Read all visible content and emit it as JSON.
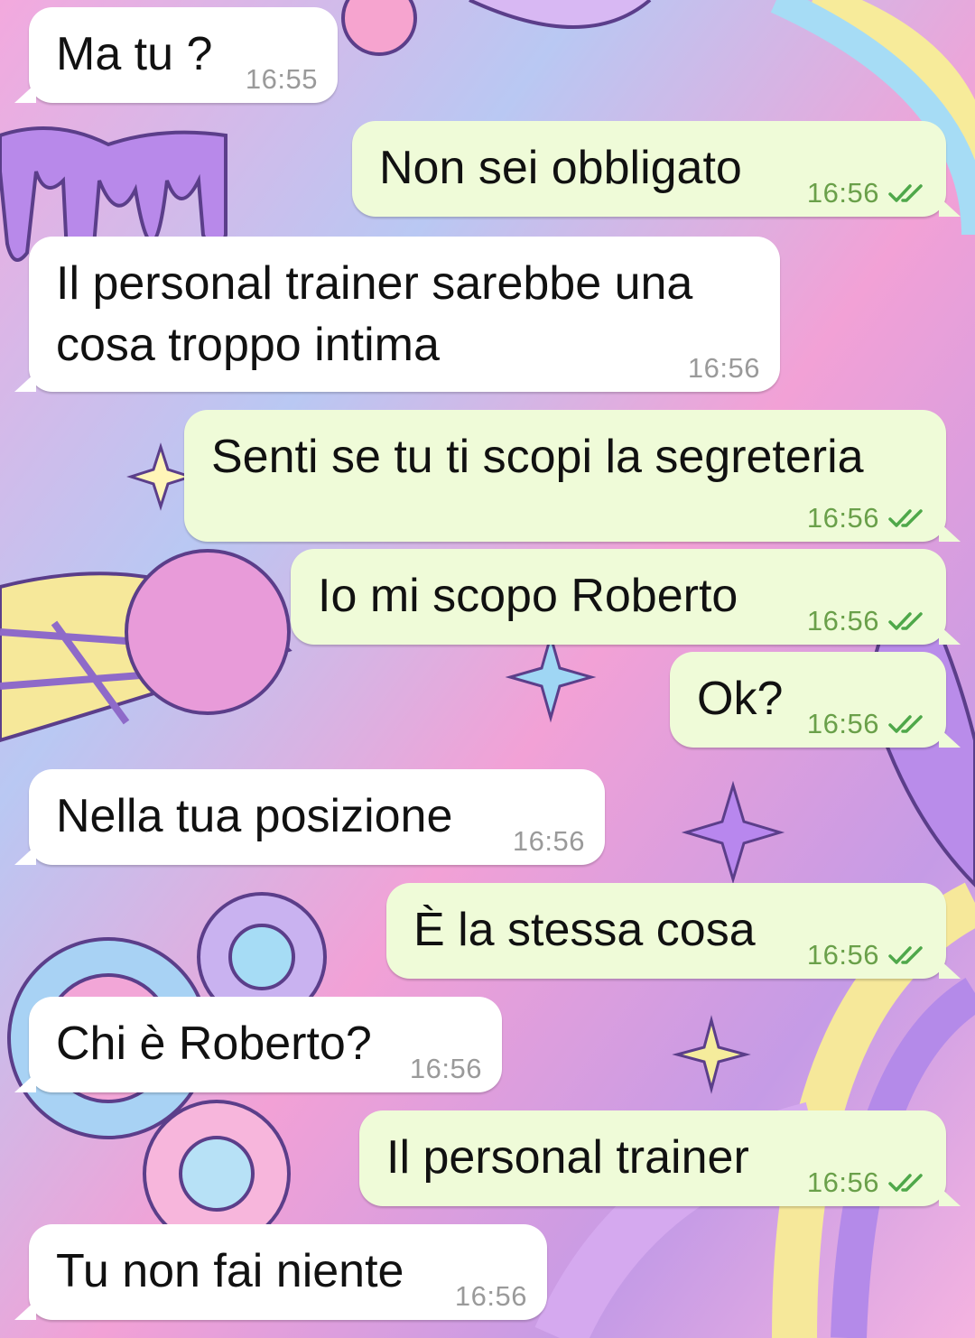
{
  "conversation": {
    "messages": [
      {
        "direction": "in",
        "text": "Ma tu ?",
        "time": "16:55",
        "read": false
      },
      {
        "direction": "out",
        "text": "Non sei obbligato",
        "time": "16:56",
        "read": true
      },
      {
        "direction": "in",
        "text": "Il personal trainer sarebbe una\ncosa troppo intima",
        "time": "16:56",
        "read": false
      },
      {
        "direction": "out",
        "text": "Senti se tu ti scopi la segreteria",
        "time": "16:56",
        "read": true
      },
      {
        "direction": "out",
        "text": "Io mi scopo Roberto",
        "time": "16:56",
        "read": true
      },
      {
        "direction": "out",
        "text": "Ok?",
        "time": "16:56",
        "read": true
      },
      {
        "direction": "in",
        "text": "Nella tua posizione",
        "time": "16:56",
        "read": false
      },
      {
        "direction": "out",
        "text": "È la stessa cosa",
        "time": "16:56",
        "read": true
      },
      {
        "direction": "in",
        "text": "Chi è Roberto?",
        "time": "16:56",
        "read": false
      },
      {
        "direction": "out",
        "text": "Il personal trainer",
        "time": "16:56",
        "read": true
      },
      {
        "direction": "in",
        "text": "Tu non fai niente",
        "time": "16:56",
        "read": false
      }
    ]
  },
  "theme": {
    "incoming_bubble": "#ffffff",
    "outgoing_bubble": "#effbd8",
    "read_tick_color": "#4fa84a",
    "wallpaper_style": "psychedelic pastel pink, purple, blue and yellow"
  },
  "icons": {
    "read_receipt": "double-check-icon"
  }
}
